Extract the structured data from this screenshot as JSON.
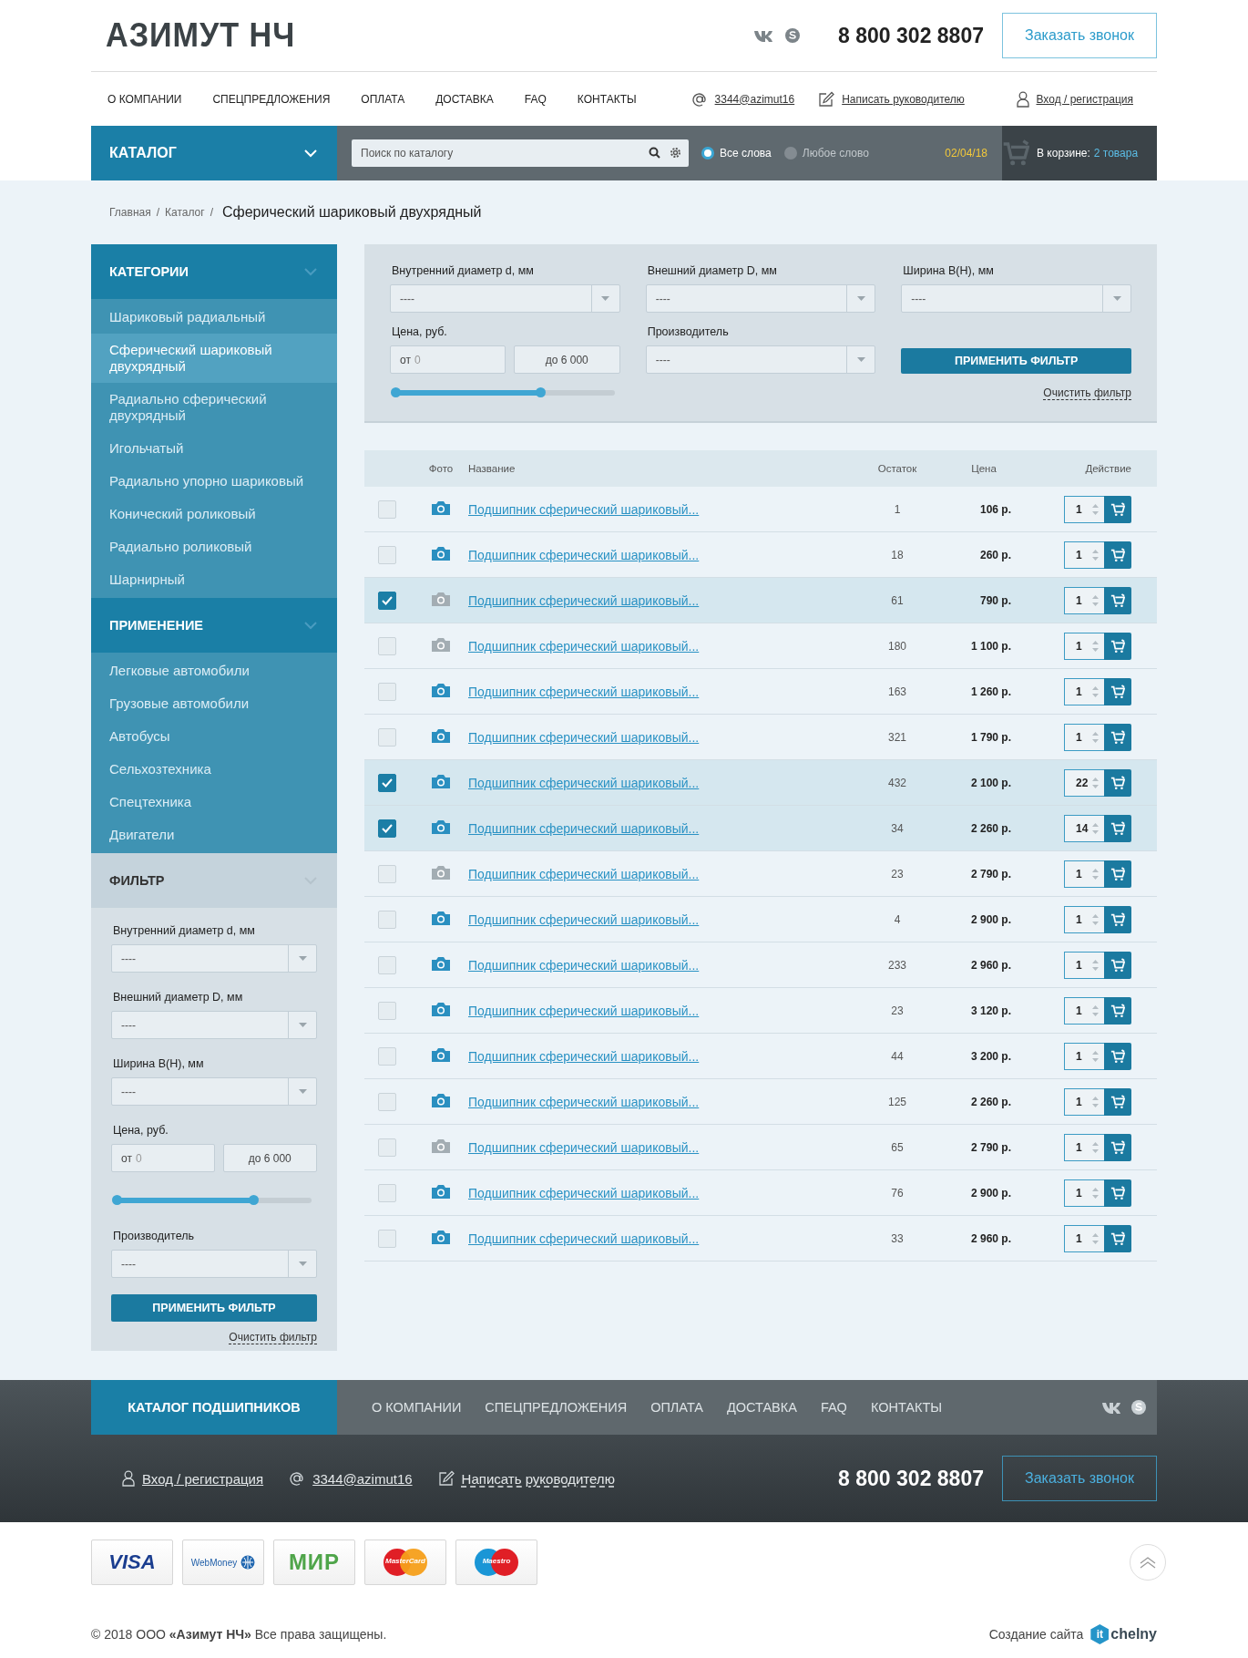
{
  "header": {
    "logo": "АЗИМУТ НЧ",
    "phone": "8 800 302 8807",
    "callback_button": "Заказать звонок"
  },
  "nav": {
    "items": [
      "О КОМПАНИИ",
      "СПЕЦПРЕДЛОЖЕНИЯ",
      "ОПЛАТА",
      "ДОСТАВКА",
      "FAQ",
      "КОНТАКТЫ"
    ],
    "email": "3344@azimut16",
    "write_manager": "Написать руководителю",
    "login": "Вход / регистрация"
  },
  "catalog_bar": {
    "catalog_button": "КАТАЛОГ",
    "search": {
      "placeholder": "Поиск по каталогу"
    },
    "search_modes": [
      {
        "label": "Все слова",
        "selected": true
      },
      {
        "label": "Любое слово",
        "selected": false
      }
    ],
    "date": "02/04/18",
    "cart_label": "В корзине:",
    "cart_link": "2 товара"
  },
  "breadcrumbs": {
    "separator": "/",
    "items": [
      {
        "label": "Главная",
        "kind": "link"
      },
      {
        "label": "Каталог",
        "kind": "link"
      },
      {
        "label": "Сферический шариковый двухрядный",
        "kind": "current"
      }
    ]
  },
  "sidebar": {
    "sections": [
      {
        "title": "КАТЕГОРИИ",
        "kind": "nav",
        "items": [
          {
            "label": "Шариковый радиальный",
            "selected": false
          },
          {
            "label": "Сферический шариковый двухрядный",
            "selected": true
          },
          {
            "label": "Радиально сферический двухрядный",
            "selected": false
          },
          {
            "label": "Игольчатый",
            "selected": false
          },
          {
            "label": "Радиально упорно шариковый",
            "selected": false
          },
          {
            "label": "Конический роликовый",
            "selected": false
          },
          {
            "label": "Радиально роликовый",
            "selected": false
          },
          {
            "label": "Шарнирный",
            "selected": false
          }
        ]
      },
      {
        "title": "ПРИМЕНЕНИЕ",
        "kind": "nav",
        "items": [
          {
            "label": "Легковые автомобили",
            "selected": false
          },
          {
            "label": "Грузовые автомобили",
            "selected": false
          },
          {
            "label": "Автобусы",
            "selected": false
          },
          {
            "label": "Сельхозтехника",
            "selected": false
          },
          {
            "label": "Спецтехника",
            "selected": false
          },
          {
            "label": "Двигатели",
            "selected": false
          }
        ]
      },
      {
        "title": "ФИЛЬТР",
        "kind": "filter"
      }
    ]
  },
  "sidebar_filter": {
    "inner_diameter": {
      "label": "Внутренний диаметр d, мм",
      "value": "----"
    },
    "outer_diameter": {
      "label": "Внешний диаметр D, мм",
      "value": "----"
    },
    "width": {
      "label": "Ширина B(H), мм",
      "value": "----"
    },
    "price": {
      "label": "Цена, руб.",
      "from_prefix": "от",
      "from_value": "0",
      "to_value": "до 6 000",
      "level": 0.7
    },
    "manufacturer": {
      "label": "Производитель",
      "value": "----"
    },
    "apply_button": "ПРИМЕНИТЬ ФИЛЬТР",
    "clear_link": "Очистить фильтр"
  },
  "filter": {
    "inner_diameter": {
      "label": "Внутренний диаметр d, мм",
      "value": "----"
    },
    "outer_diameter": {
      "label": "Внешний диаметр D, мм",
      "value": "----"
    },
    "width": {
      "label": "Ширина B(H), мм",
      "value": "----"
    },
    "price": {
      "label": "Цена, руб.",
      "from_prefix": "от",
      "from_value": "0",
      "to_value": "до 6 000",
      "level": 0.66
    },
    "manufacturer": {
      "label": "Производитель",
      "value": "----"
    },
    "apply_button": "ПРИМЕНИТЬ ФИЛЬТР",
    "clear_link": "Очистить фильтр"
  },
  "table": {
    "columns": [
      "Фото",
      "Название",
      "Остаток",
      "Цена",
      "Действие"
    ],
    "rows": [
      {
        "selected": false,
        "has_photo": true,
        "name": "Подшипник сферический шариковый...",
        "stock": "1",
        "price": "106 р.",
        "quantity": "1"
      },
      {
        "selected": false,
        "has_photo": true,
        "name": "Подшипник сферический шариковый...",
        "stock": "18",
        "price": "260 р.",
        "quantity": "1"
      },
      {
        "selected": true,
        "has_photo": false,
        "name": "Подшипник сферический шариковый...",
        "stock": "61",
        "price": "790 р.",
        "quantity": "1"
      },
      {
        "selected": false,
        "has_photo": false,
        "name": "Подшипник сферический шариковый...",
        "stock": "180",
        "price": "1 100 р.",
        "quantity": "1"
      },
      {
        "selected": false,
        "has_photo": true,
        "name": "Подшипник сферический шариковый...",
        "stock": "163",
        "price": "1 260 р.",
        "quantity": "1"
      },
      {
        "selected": false,
        "has_photo": true,
        "name": "Подшипник сферический шариковый...",
        "stock": "321",
        "price": "1 790 р.",
        "quantity": "1"
      },
      {
        "selected": true,
        "has_photo": true,
        "name": "Подшипник сферический шариковый...",
        "stock": "432",
        "price": "2 100 р.",
        "quantity": "22"
      },
      {
        "selected": true,
        "has_photo": true,
        "name": "Подшипник сферический шариковый...",
        "stock": "34",
        "price": "2 260 р.",
        "quantity": "14"
      },
      {
        "selected": false,
        "has_photo": false,
        "name": "Подшипник сферический шариковый...",
        "stock": "23",
        "price": "2 790 р.",
        "quantity": "1"
      },
      {
        "selected": false,
        "has_photo": true,
        "name": "Подшипник сферический шариковый...",
        "stock": "4",
        "price": "2 900 р.",
        "quantity": "1"
      },
      {
        "selected": false,
        "has_photo": true,
        "name": "Подшипник сферический шариковый...",
        "stock": "233",
        "price": "2 960 р.",
        "quantity": "1"
      },
      {
        "selected": false,
        "has_photo": true,
        "name": "Подшипник сферический шариковый...",
        "stock": "23",
        "price": "3 120 р.",
        "quantity": "1"
      },
      {
        "selected": false,
        "has_photo": true,
        "name": "Подшипник сферический шариковый...",
        "stock": "44",
        "price": "3 200 р.",
        "quantity": "1"
      },
      {
        "selected": false,
        "has_photo": true,
        "name": "Подшипник сферический шариковый...",
        "stock": "125",
        "price": "2 260 р.",
        "quantity": "1"
      },
      {
        "selected": false,
        "has_photo": false,
        "name": "Подшипник сферический шариковый...",
        "stock": "65",
        "price": "2 790 р.",
        "quantity": "1"
      },
      {
        "selected": false,
        "has_photo": true,
        "name": "Подшипник сферический шариковый...",
        "stock": "76",
        "price": "2 900 р.",
        "quantity": "1"
      },
      {
        "selected": false,
        "has_photo": true,
        "name": "Подшипник сферический шариковый...",
        "stock": "33",
        "price": "2 960 р.",
        "quantity": "1"
      }
    ]
  },
  "footer": {
    "catalog_title": "КАТАЛОГ ПОДШИПНИКОВ",
    "nav_items": [
      "О КОМПАНИИ",
      "СПЕЦПРЕДЛОЖЕНИЯ",
      "ОПЛАТА",
      "ДОСТАВКА",
      "FAQ",
      "КОНТАКТЫ"
    ],
    "login": "Вход / регистрация",
    "email": "3344@azimut16",
    "write_manager": "Написать руководителю",
    "phone": "8 800 302 8807",
    "callback_button": "Заказать звонок",
    "payments": [
      {
        "kind": "visa",
        "label": "VISA"
      },
      {
        "kind": "webmoney",
        "label": "WebMoney"
      },
      {
        "kind": "mir",
        "label": "МИР"
      },
      {
        "kind": "mastercard",
        "label": "MasterCard"
      },
      {
        "kind": "maestro",
        "label": "Maestro"
      }
    ],
    "copyright": "© 2018  ООО **«Азимут НЧ»** Все права защищены.",
    "credit": "Создание сайта",
    "credit_logo_mark": "it",
    "credit_logo_text": "chelny"
  }
}
